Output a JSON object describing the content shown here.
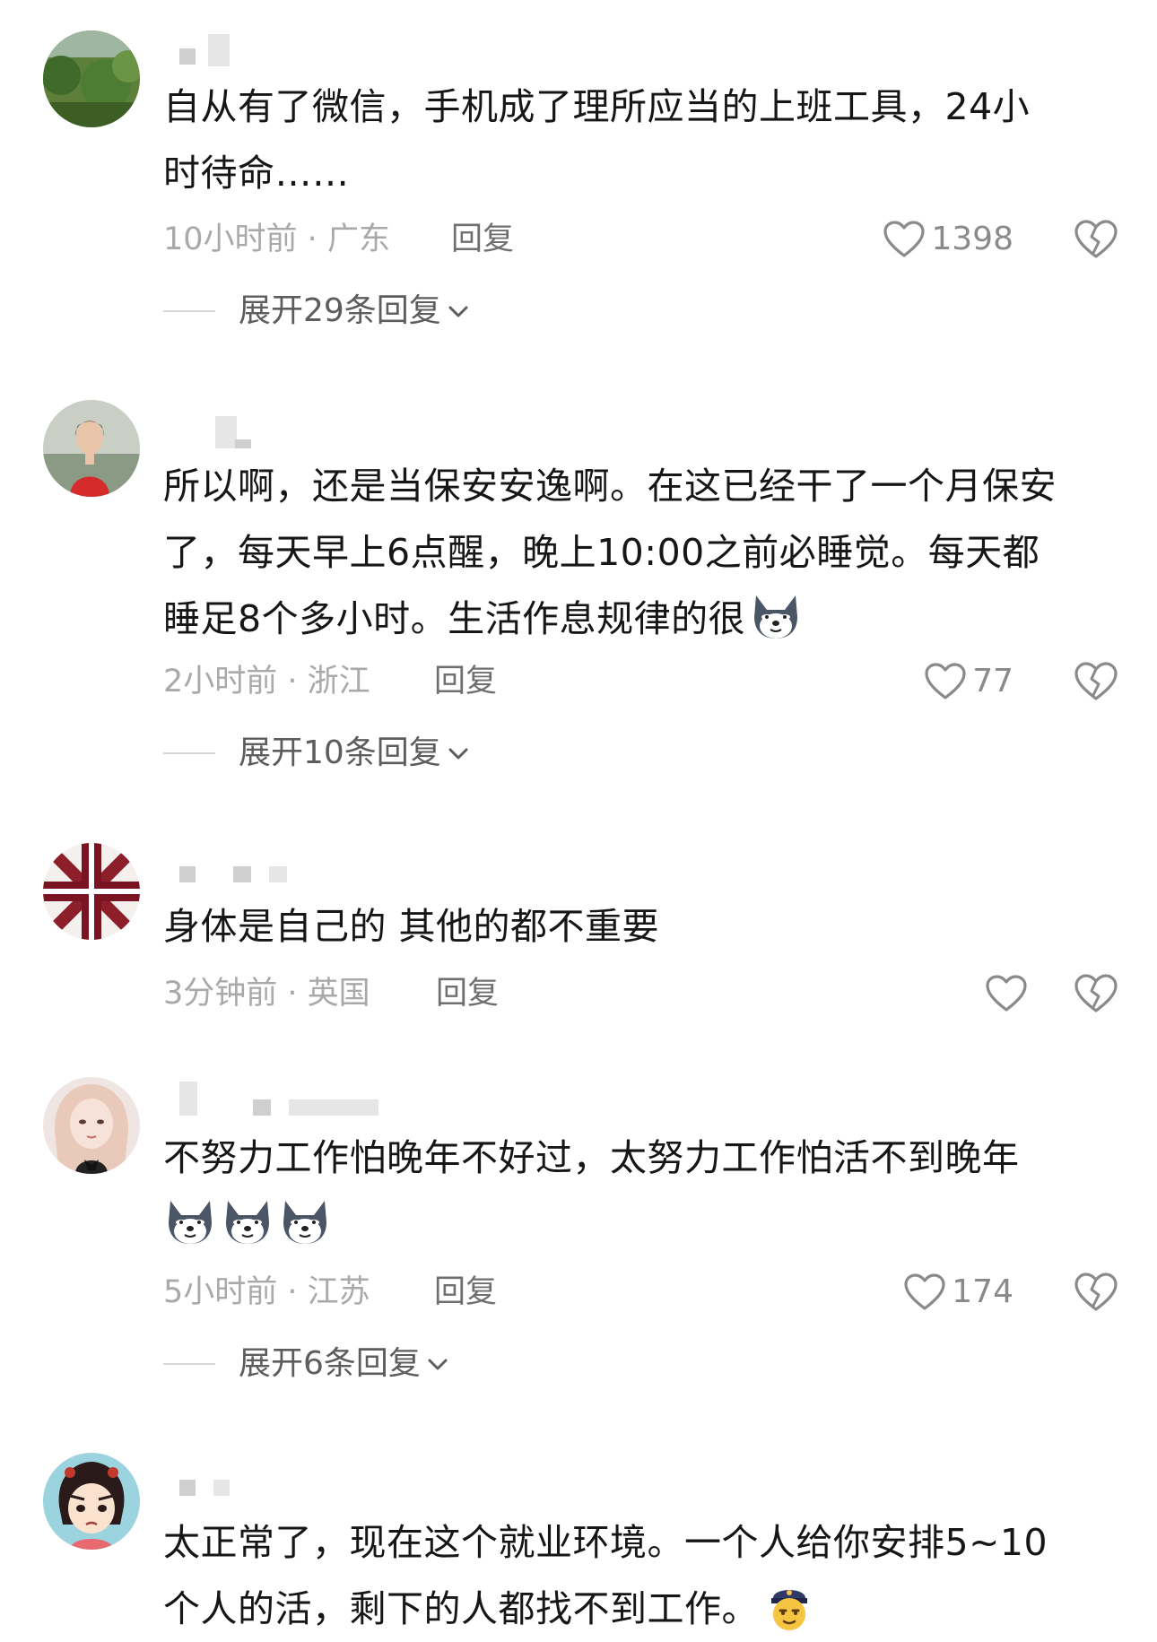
{
  "comments": [
    {
      "lines": [
        "自从有了微信，手机成了理所应当的上班工具，24小",
        "时待命……"
      ],
      "time": "10小时前",
      "location": "广东",
      "reply_label": "回复",
      "likes": "1398",
      "expand_label": "展开29条回复"
    },
    {
      "lines": [
        "所以啊，还是当保安安逸啊。在这已经干了一个月保安",
        "了，每天早上6点醒，晚上10:00之前必睡觉。每天都",
        "睡足8个多小时。生活作息规律的很"
      ],
      "emoji": [
        "husky-emoji"
      ],
      "time": "2小时前",
      "location": "浙江",
      "reply_label": "回复",
      "likes": "77",
      "expand_label": "展开10条回复"
    },
    {
      "lines": [
        "身体是自己的 其他的都不重要"
      ],
      "time": "3分钟前",
      "location": "英国",
      "reply_label": "回复",
      "likes": ""
    },
    {
      "lines": [
        "不努力工作怕晚年不好过，太努力工作怕活不到晚年"
      ],
      "emoji": [
        "husky-emoji",
        "husky-emoji",
        "husky-emoji"
      ],
      "time": "5小时前",
      "location": "江苏",
      "reply_label": "回复",
      "likes": "174",
      "expand_label": "展开6条回复"
    },
    {
      "lines": [
        "太正常了，现在这个就业环境。一个人给你安排5~10",
        "个人的活，剩下的人都找不到工作。"
      ],
      "emoji": [
        "cop-face-emoji"
      ]
    }
  ],
  "colors": {
    "text": "#161616",
    "meta": "#a9a9a9",
    "reply": "#6f6f6f",
    "icon": "#8a8a8a"
  },
  "icons": [
    "heart-icon",
    "heart-broken-icon",
    "chevron-down-icon"
  ]
}
